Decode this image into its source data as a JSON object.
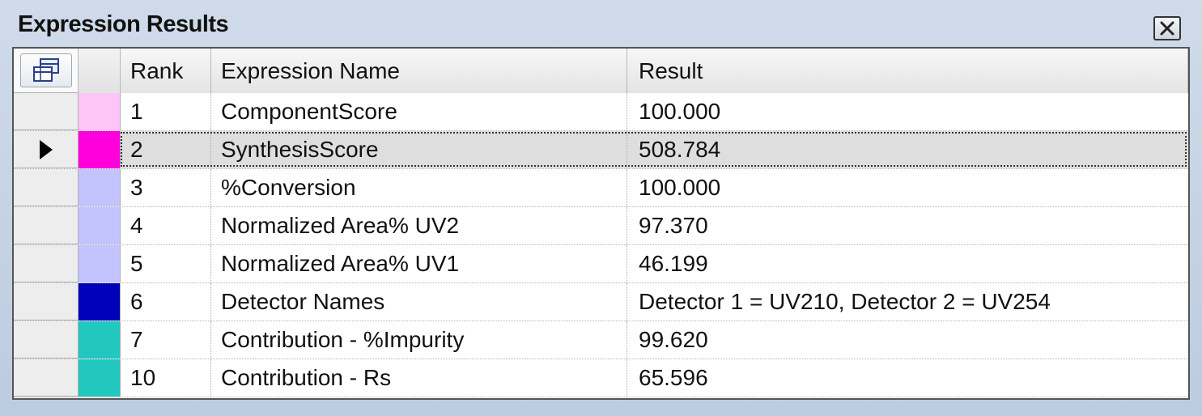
{
  "window": {
    "title": "Expression Results"
  },
  "columns": {
    "rank": "Rank",
    "name": "Expression Name",
    "result": "Result"
  },
  "rows": [
    {
      "rank": "1",
      "name": "ComponentScore",
      "result": "100.000",
      "color": "#ffc4f6",
      "selected": false
    },
    {
      "rank": "2",
      "name": "SynthesisScore",
      "result": "508.784",
      "color": "#ff00dc",
      "selected": true
    },
    {
      "rank": "3",
      "name": "%Conversion",
      "result": "100.000",
      "color": "#c3c3ff",
      "selected": false
    },
    {
      "rank": "4",
      "name": "Normalized Area% UV2",
      "result": "97.370",
      "color": "#c3c3ff",
      "selected": false
    },
    {
      "rank": "5",
      "name": "Normalized Area% UV1",
      "result": "46.199",
      "color": "#c3c3ff",
      "selected": false
    },
    {
      "rank": "6",
      "name": "Detector Names",
      "result": "Detector 1 = UV210, Detector 2 = UV254",
      "color": "#0000b8",
      "selected": false
    },
    {
      "rank": "7",
      "name": "Contribution - %Impurity",
      "result": "99.620",
      "color": "#22c7be",
      "selected": false
    },
    {
      "rank": "10",
      "name": "Contribution - Rs",
      "result": "65.596",
      "color": "#22c7be",
      "selected": false
    }
  ],
  "icons": {
    "close": "close-icon",
    "select_all": "select-all-icon",
    "row_pointer": "row-pointer-icon"
  }
}
